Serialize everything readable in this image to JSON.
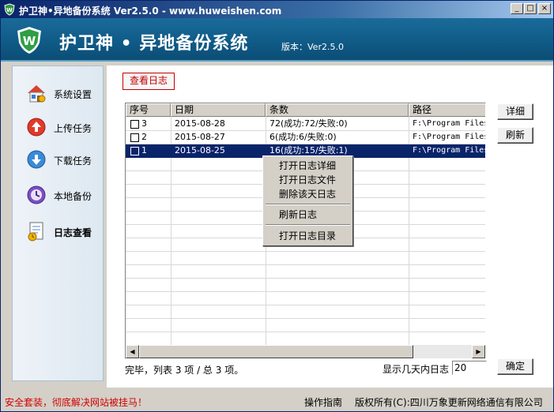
{
  "window": {
    "title": "护卫神•异地备份系统 Ver2.5.0 - www.huweishen.com",
    "minimize": "_",
    "maximize": "□",
    "close": "×"
  },
  "banner": {
    "title": "护卫神 • 异地备份系统",
    "version": "版本：Ver2.5.0",
    "logo_icon": "shield-w-logo"
  },
  "sidebar": {
    "items": [
      {
        "label": "系统设置",
        "icon": "house-settings-icon"
      },
      {
        "label": "上传任务",
        "icon": "upload-arrow-icon"
      },
      {
        "label": "下载任务",
        "icon": "download-arrow-icon"
      },
      {
        "label": "本地备份",
        "icon": "clock-backup-icon"
      },
      {
        "label": "日志查看",
        "icon": "log-document-icon",
        "active": true
      }
    ]
  },
  "toolbar": {
    "view_log": "查看日志"
  },
  "table": {
    "columns": [
      "序号",
      "日期",
      "条数",
      "路径"
    ],
    "rows": [
      {
        "no": "3",
        "date": "2015-08-28",
        "count": "72(成功:72/失败:0)",
        "path": "F:\\Program Files",
        "selected": false
      },
      {
        "no": "2",
        "date": "2015-08-27",
        "count": "6(成功:6/失败:0)",
        "path": "F:\\Program Files",
        "selected": false
      },
      {
        "no": "1",
        "date": "2015-08-25",
        "count": "16(成功:15/失败:1)",
        "path": "F:\\Program Files",
        "selected": true
      }
    ]
  },
  "context_menu": {
    "items": [
      "打开日志详细",
      "打开日志文件",
      "删除该天日志",
      "刷新日志",
      "打开日志目录"
    ]
  },
  "buttons": {
    "detail": "详细",
    "refresh": "刷新",
    "ok": "确定"
  },
  "status": {
    "summary": "完毕，列表 3 项 / 总 3 项。",
    "days_label": "显示几天内日志",
    "days_value": "20"
  },
  "footer": {
    "warning": "安全套装，彻底解决网站被挂马！",
    "guide": "操作指南",
    "copyright": "版权所有(C):四川万象更新网络通信有限公司"
  },
  "colors": {
    "banner": "#0f5a86",
    "selection": "#0a246a",
    "accent_red": "#c00000"
  }
}
